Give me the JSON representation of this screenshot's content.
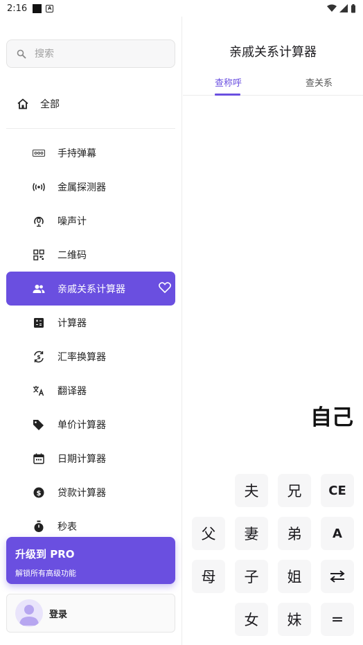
{
  "status": {
    "time": "2:16"
  },
  "search": {
    "placeholder": "搜索"
  },
  "sidebar": {
    "all_label": "全部",
    "items": [
      {
        "label": "手持弹幕",
        "icon": "marquee-icon",
        "active": false
      },
      {
        "label": "金属探测器",
        "icon": "sensor-icon",
        "active": false
      },
      {
        "label": "噪声计",
        "icon": "noise-meter-icon",
        "active": false
      },
      {
        "label": "二维码",
        "icon": "qr-code-icon",
        "active": false
      },
      {
        "label": "亲戚关系计算器",
        "icon": "people-icon",
        "active": true
      },
      {
        "label": "计算器",
        "icon": "calculator-icon",
        "active": false
      },
      {
        "label": "汇率换算器",
        "icon": "currency-exchange-icon",
        "active": false
      },
      {
        "label": "翻译器",
        "icon": "translate-icon",
        "active": false
      },
      {
        "label": "单价计算器",
        "icon": "price-tag-icon",
        "active": false
      },
      {
        "label": "日期计算器",
        "icon": "calendar-icon",
        "active": false
      },
      {
        "label": "贷款计算器",
        "icon": "dollar-icon",
        "active": false
      },
      {
        "label": "秒表",
        "icon": "stopwatch-icon",
        "active": false
      }
    ],
    "promo": {
      "title": "升级到 PRO",
      "subtitle": "解锁所有高级功能"
    },
    "login_label": "登录"
  },
  "main": {
    "title": "亲戚关系计算器",
    "tabs": [
      {
        "label": "查称呼",
        "active": true
      },
      {
        "label": "查关系",
        "active": false
      }
    ],
    "display": "自己",
    "keys": {
      "husband": "夫",
      "elder_brother": "兄",
      "ce": "CE",
      "father": "父",
      "wife": "妻",
      "younger_brother": "弟",
      "a": "A",
      "mother": "母",
      "son": "子",
      "elder_sister": "姐",
      "daughter": "女",
      "younger_sister": "妹",
      "equals": "＝"
    }
  },
  "colors": {
    "accent": "#6a4fe0",
    "key_bg": "#f6f6f7"
  }
}
